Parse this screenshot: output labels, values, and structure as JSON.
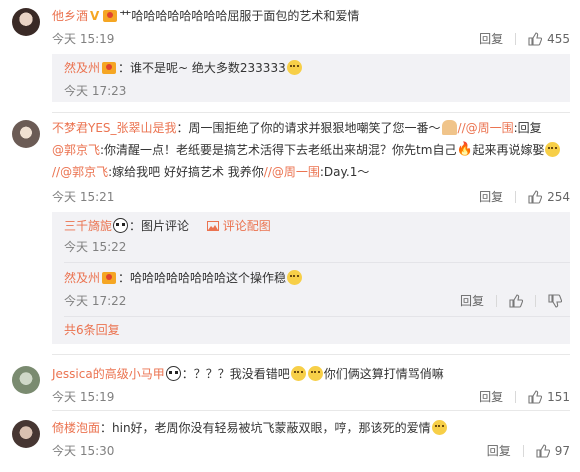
{
  "comments": [
    {
      "user": "他乡酒",
      "text": "艹哈哈哈哈哈哈哈哈屈服于面包的艺术和爱情",
      "time": "今天 15:19",
      "reply_label": "回复",
      "likes": "455",
      "replies": [
        {
          "user": "然及州",
          "text": "谁不是呢~ 绝大多数233333",
          "time": "今天 17:23"
        }
      ]
    },
    {
      "user": "不梦君YES_张翠山是我",
      "text_l1": "：周一围拒绝了你的请求并狠狠地嘲笑了您一番～",
      "text_l1_link": "//@周一围",
      "text_l1_tail": ":回复",
      "text_l2_link": "@郭京飞",
      "text_l2": ":你清醒一点！老纸要是搞艺术活得下去老纸出来胡混？你先tm自己",
      "text_l2_tail": "起来再说嫁娶",
      "text_l3_link1": "//@郭京飞",
      "text_l3": ":嫁给我吧 好好搞艺术 我养你",
      "text_l3_link2": "//@周一围",
      "text_l3_tail": ":Day.1～",
      "time": "今天 15:21",
      "reply_label": "回复",
      "likes": "254",
      "replies": [
        {
          "user": "三千旖旎",
          "text": "：图片评论",
          "extra": "评论配图",
          "time": "今天 15:22"
        },
        {
          "user": "然及州",
          "text": "：哈哈哈哈哈哈哈哈这个操作稳",
          "time": "今天 17:22"
        }
      ],
      "more_replies": "共6条回复"
    },
    {
      "user": "Jessica的高级小马甲",
      "text": "：？？？我没看错吧",
      "text_tail": "你们俩这算打情骂俏嘛",
      "time": "今天 15:19",
      "reply_label": "回复",
      "likes": "151"
    },
    {
      "user": "倚楼泡面",
      "text": "：hin好，老周你没有轻易被坑飞蒙蔽双眼，哼，那该死的爱情",
      "time": "今天 15:30",
      "reply_label": "回复",
      "likes": "97"
    }
  ],
  "sub_reply_label": "回复",
  "colors": {
    "accent": "#eb7350",
    "meta": "#808080",
    "subbg": "#f2f2f5"
  },
  "icons": [
    "thumb-up-icon",
    "thumb-down-icon",
    "image-icon",
    "vip-badge-icon"
  ]
}
